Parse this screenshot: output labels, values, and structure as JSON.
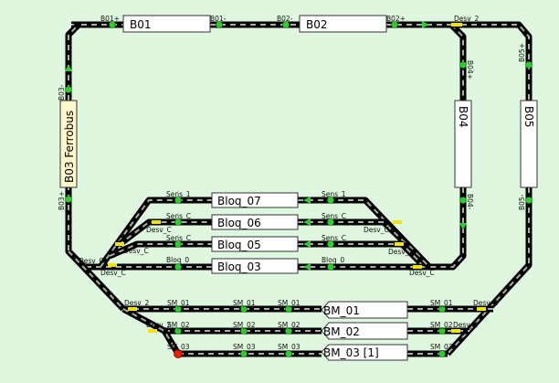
{
  "colors": {
    "background": "#dff7df",
    "rail": "#000000",
    "sleeper": "#aaaaaa",
    "sensor_on": "#2ecc2e",
    "sensor_alert": "#ee2200",
    "switch": "#f2e600",
    "block_fill": "#ffffff",
    "ferrobus_fill": "#fff7cc",
    "direction_arrow": "#2ecc2e"
  },
  "blocks": {
    "b01": "B01",
    "b02": "B02",
    "b03": "B03 Ferrobus",
    "b04": "B04",
    "b05": "B05",
    "bloq07": "Bloq_07",
    "bloq06": "Bloq_06",
    "bloq05": "Bloq_05",
    "bloq03": "Bloq_03",
    "bm01": "BM_01",
    "bm02": "BM_02",
    "bm03": "BM_03 [1]"
  },
  "labels": {
    "b01_plus": "B01+",
    "b01_minus": "B01-",
    "b02_minus": "B02-",
    "b02_plus": "B02+",
    "desv_top_right": "Desv_2",
    "b04_plus": "B04+",
    "b04_minus": "B04-",
    "b05_plus": "B05+",
    "b05_minus": "B05-",
    "b03_minus": "B03-",
    "b03_plus": "B03+",
    "sens1_left": "Sens_1",
    "sens1_right": "Sens_1",
    "sens_c1_left": "Sens_C",
    "sens_c1_right": "Sens_C",
    "desv_c_left": "Desv_C",
    "desv_c_right": "Desv_C",
    "sens_c2_left": "Sens_C",
    "sens_c2_right": "Sens_C",
    "desv_ll_a": "Desv_C",
    "desv_ll_b": "Desv_2",
    "bloq_0_left": "Bloq_0",
    "bloq_0_right": "Bloq_0",
    "desv_ll_c": "Desv_C",
    "desv_lr": "Desv_C",
    "sm_desv_2a": "Desv_2",
    "sm_01_a": "SM_01",
    "sm_01_b": "SM_01",
    "sm_01_c": "SM_01",
    "sm_01_d": "SM_01",
    "sm_desv_r1": "Desv_2",
    "sm_desv_2b": "Desv_2",
    "sm_02_a": "SM_02",
    "sm_02_b": "SM_02",
    "sm_02_c": "SM_02",
    "sm_02_d": "SM_02",
    "sm_desv_r2": "Desv_2",
    "sm_03_a": "SM_03",
    "sm_03_b": "SM_03",
    "sm_03_c": "SM_03",
    "sm_03_d": "SM_03"
  }
}
